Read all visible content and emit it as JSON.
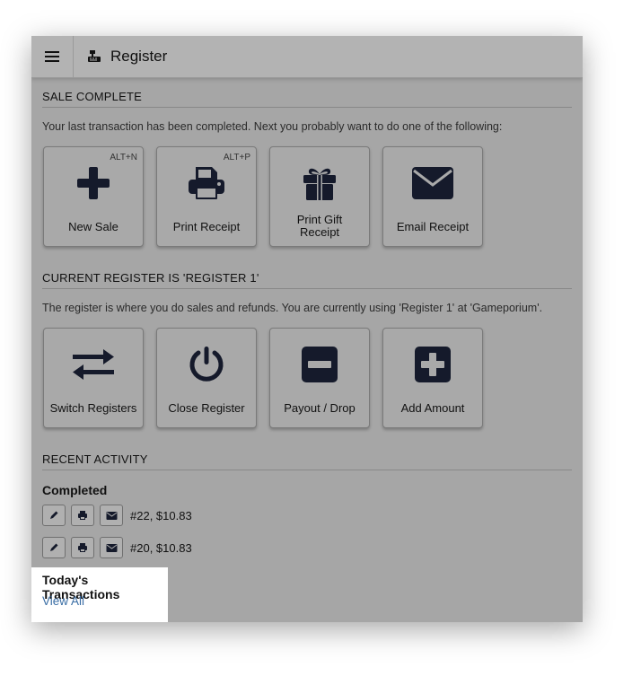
{
  "header": {
    "title": "Register"
  },
  "sale_complete": {
    "heading": "SALE COMPLETE",
    "description": "Your last transaction has been completed. Next you probably want to do one of the following:",
    "tiles": [
      {
        "label": "New Sale",
        "hotkey": "ALT+N",
        "icon": "plus-icon"
      },
      {
        "label": "Print Receipt",
        "hotkey": "ALT+P",
        "icon": "printer-icon"
      },
      {
        "label": "Print Gift Receipt",
        "hotkey": "",
        "icon": "gift-icon"
      },
      {
        "label": "Email Receipt",
        "hotkey": "",
        "icon": "envelope-icon"
      }
    ]
  },
  "current_register": {
    "heading": "CURRENT REGISTER IS 'REGISTER 1'",
    "description": "The register is where you do sales and refunds. You are currently using 'Register 1'  at 'Gameporium'.",
    "tiles": [
      {
        "label": "Switch Registers",
        "icon": "switch-arrows-icon"
      },
      {
        "label": "Close Register",
        "icon": "power-icon"
      },
      {
        "label": "Payout / Drop",
        "icon": "minus-square-icon"
      },
      {
        "label": "Add Amount",
        "icon": "plus-square-icon"
      }
    ]
  },
  "recent_activity": {
    "heading": "RECENT ACTIVITY",
    "subheading": "Completed",
    "items": [
      {
        "text": "#22, $10.83"
      },
      {
        "text": "#20, $10.83"
      }
    ]
  },
  "todays_transactions": {
    "title": "Today's Transactions",
    "link": "View All"
  },
  "colors": {
    "overlay": "#a6a6a6",
    "link": "#3a6ea5",
    "icon": "#151a2b"
  }
}
